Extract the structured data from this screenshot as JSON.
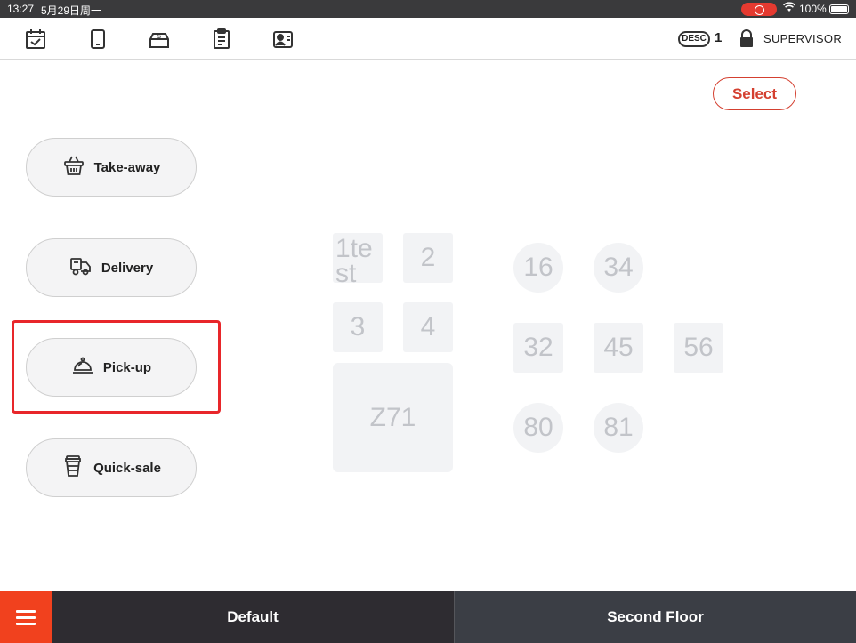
{
  "status_bar": {
    "time": "13:27",
    "date": "5月29日周一",
    "battery": "100%"
  },
  "toolbar": {
    "icons": [
      "calendar-check-icon",
      "tablet-icon",
      "cash-drawer-icon",
      "clipboard-list-icon",
      "user-card-icon"
    ],
    "desc_label": "DESC",
    "desc_count": "1",
    "role": "SUPERVISOR"
  },
  "main": {
    "select_label": "Select",
    "modes": [
      {
        "label": "Take-away",
        "icon": "basket-icon"
      },
      {
        "label": "Delivery",
        "icon": "delivery-truck-icon"
      },
      {
        "label": "Pick-up",
        "icon": "cloche-icon"
      },
      {
        "label": "Quick-sale",
        "icon": "takeaway-cup-icon"
      }
    ],
    "highlighted_mode": "Pick-up",
    "tables": {
      "t1test": "1test",
      "t2": "2",
      "t3": "3",
      "t4": "4",
      "z71": "Z71",
      "t16": "16",
      "t34": "34",
      "t32": "32",
      "t45": "45",
      "t56": "56",
      "t80": "80",
      "t81": "81"
    }
  },
  "bottom_bar": {
    "menu_icon": "hamburger-menu-icon",
    "floors": [
      "Default",
      "Second Floor"
    ],
    "active_floor": "Default"
  },
  "colors": {
    "accent": "#f1411e",
    "select_red": "#d44030",
    "highlight_red": "#e8262a",
    "bottom_bar": "#2e2c31",
    "table_fill": "#f2f3f5",
    "table_text": "#c2c4c9"
  }
}
